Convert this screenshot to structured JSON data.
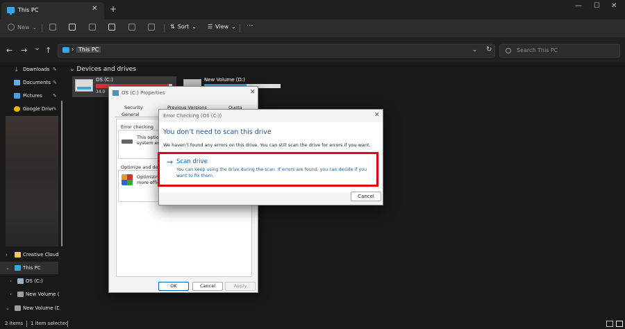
{
  "window": {
    "tab_title": "This PC",
    "tab_close": "✕",
    "new_tab": "+",
    "min": "—",
    "max": "☐",
    "close": "✕"
  },
  "toolbar": {
    "new_label": "New",
    "sort_label": "Sort",
    "view_label": "View",
    "more_label": "···"
  },
  "nav": {
    "back": "←",
    "forward": "→",
    "history": "⌄",
    "up": "↑",
    "breadcrumb": "This PC",
    "dropdown": "⌄",
    "refresh": "↻",
    "search_placeholder": "Search This PC"
  },
  "sidebar": {
    "quick": [
      {
        "label": "Downloads",
        "color": "#4caf50"
      },
      {
        "label": "Documents",
        "color": "#6aa8e8"
      },
      {
        "label": "Pictures",
        "color": "#4d9fe0"
      },
      {
        "label": "Google Drive",
        "color": "#f4b400"
      }
    ],
    "tree": [
      {
        "label": "Creative Cloud F",
        "color": "#f2c94c"
      },
      {
        "label": "This PC",
        "color": "#35a7e6"
      },
      {
        "label": "OS (C:)",
        "color": "#8fb3d1"
      },
      {
        "label": "New Volume (",
        "color": "#9e9e9e"
      },
      {
        "label": "New Volume (D:",
        "color": "#9e9e9e"
      }
    ]
  },
  "content": {
    "section_title": "Devices and drives",
    "drive_c": {
      "name": "OS (C:)",
      "free": "34.9",
      "used_fraction": 0.95
    },
    "drive_d": {
      "name": "New Volume (D:)",
      "used_fraction": 0.55
    }
  },
  "properties": {
    "title": "OS (C:) Properties",
    "close": "✕",
    "tabs": [
      "Security",
      "Previous Versions",
      "Quota",
      "General"
    ],
    "error_group": "Error checking",
    "error_text_1": "This option",
    "error_text_2": "system erro",
    "optimize_group": "Optimize and defra",
    "optimize_text_1": "Optimizin",
    "optimize_text_2": "more effic",
    "ok": "OK",
    "cancel": "Cancel",
    "apply": "Apply"
  },
  "error_check": {
    "title": "Error Checking (OS (C:))",
    "close": "✕",
    "heading": "You don’t need to scan this drive",
    "description": "We haven’t found any errors on this drive. You can still scan the drive for errors if you want.",
    "scan_arrow": "→",
    "scan_title": "Scan drive",
    "scan_desc": "You can keep using the drive during the scan. If errors are found, you can decide if you want to fix them.",
    "cancel": "Cancel"
  },
  "status": {
    "items": "2 items",
    "selected": "1 item selected"
  },
  "colors": {
    "accent": "#0067c0",
    "highlight": "#e3000b",
    "drive_full": "#d13438"
  }
}
